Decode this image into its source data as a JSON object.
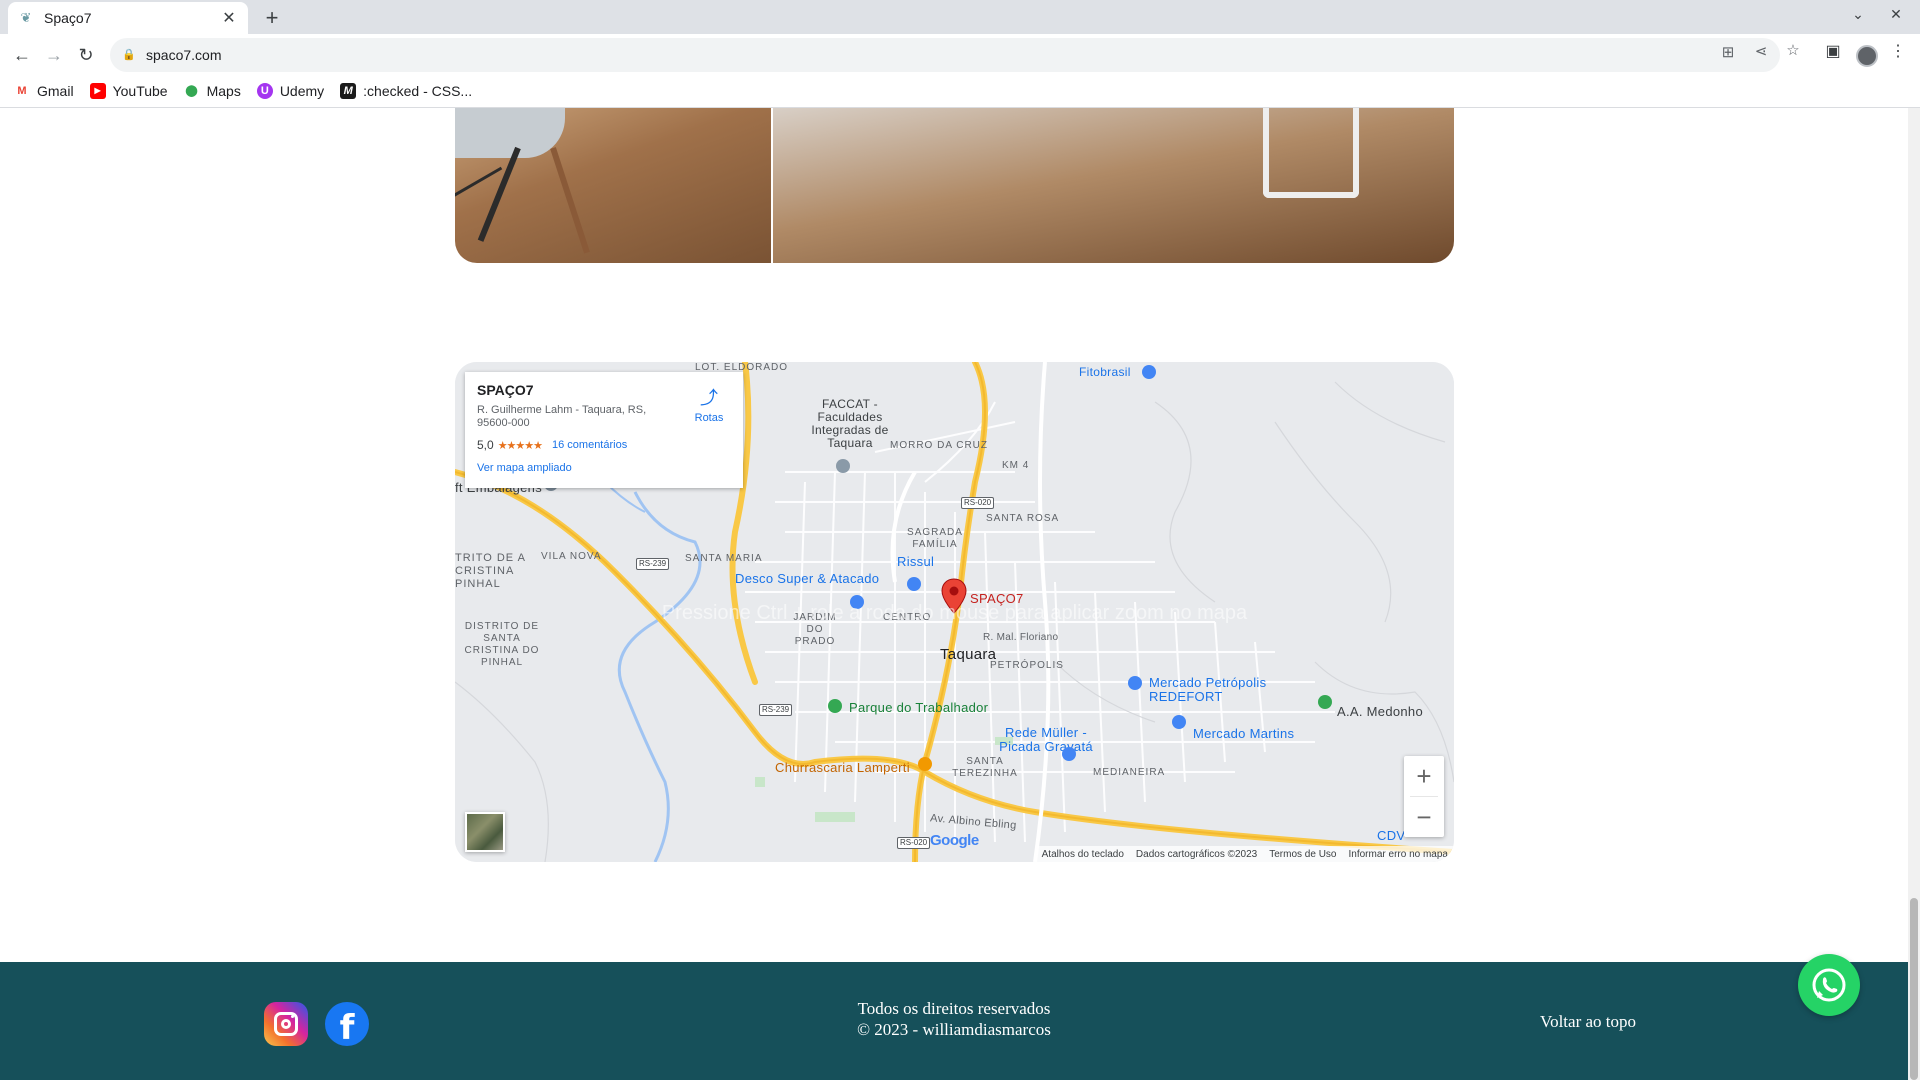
{
  "browser": {
    "tab_title": "Spaço7",
    "new_tab_glyph": "+",
    "url": "spaco7.com",
    "bookmarks": [
      {
        "label": "Gmail",
        "icon": "gmail-icon"
      },
      {
        "label": "YouTube",
        "icon": "youtube-icon"
      },
      {
        "label": "Maps",
        "icon": "maps-icon"
      },
      {
        "label": "Udemy",
        "icon": "udemy-icon"
      },
      {
        "label": ":checked - CSS...",
        "icon": "mdn-icon"
      }
    ]
  },
  "map": {
    "place_name": "SPAÇO7",
    "address": "R. Guilherme Lahm - Taquara, RS, 95600-000",
    "rating": "5,0",
    "stars": "★★★★★",
    "reviews": "16 comentários",
    "bigger_map": "Ver mapa ampliado",
    "directions": "Rotas",
    "hint": "Pressione Ctrl + role a roda do mouse para aplicar zoom no mapa",
    "pin_label": "SPAÇO7",
    "city": "Taquara",
    "neighborhoods": [
      "LOT. ELDORADO",
      "MORRO DA CRUZ",
      "KM 4",
      "SAGRADA FAMÍLIA",
      "SANTA ROSA",
      "VILA NOVA",
      "SANTA MARIA",
      "CENTRO",
      "JARDIM DO PRADO",
      "PETRÓPOLIS",
      "SANTA TEREZINHA",
      "MEDIANEIRA",
      "DISTRITO DE SANTA CRISTINA DO PINHAL",
      "TRITO DE A CRISTINA PINHAL"
    ],
    "pois": {
      "faccat": "FACCAT - Faculdades Integradas de Taquara",
      "fitobrasil": "Fitobrasil",
      "embalagens": "ft Embalagens",
      "rissul": "Rissul",
      "desco": "Desco Super & Atacado",
      "parque": "Parque do Trabalhador",
      "mercado_petropolis": "Mercado Petrópolis REDEFORT",
      "medonho": "A.A. Medonho",
      "mercado_martins": "Mercado Martins",
      "rede_muller": "Rede Müller - Picada Gravatá",
      "churrascaria": "Churrascaria Lamperti",
      "cdv": "CDV"
    },
    "streets": {
      "floriano": "R. Mal. Floriano",
      "albino": "Av. Albino Ebling"
    },
    "road_badges": [
      "RS-020",
      "RS-239",
      "RS-239",
      "RS-020"
    ],
    "google": "Google",
    "footer_links": [
      "Atalhos do teclado",
      "Dados cartográficos ©2023",
      "Termos de Uso",
      "Informar erro no mapa"
    ],
    "zoom_in": "+",
    "zoom_out": "−"
  },
  "footer": {
    "rights": "Todos os direitos reservados",
    "copyright": "© 2023 - williamdiasmarcos",
    "back_to_top": "Voltar ao topo"
  },
  "colors": {
    "footer_bg": "#16505a",
    "whatsapp": "#25d366",
    "map_pin": "#ea4335",
    "link_blue": "#1a73e8"
  }
}
